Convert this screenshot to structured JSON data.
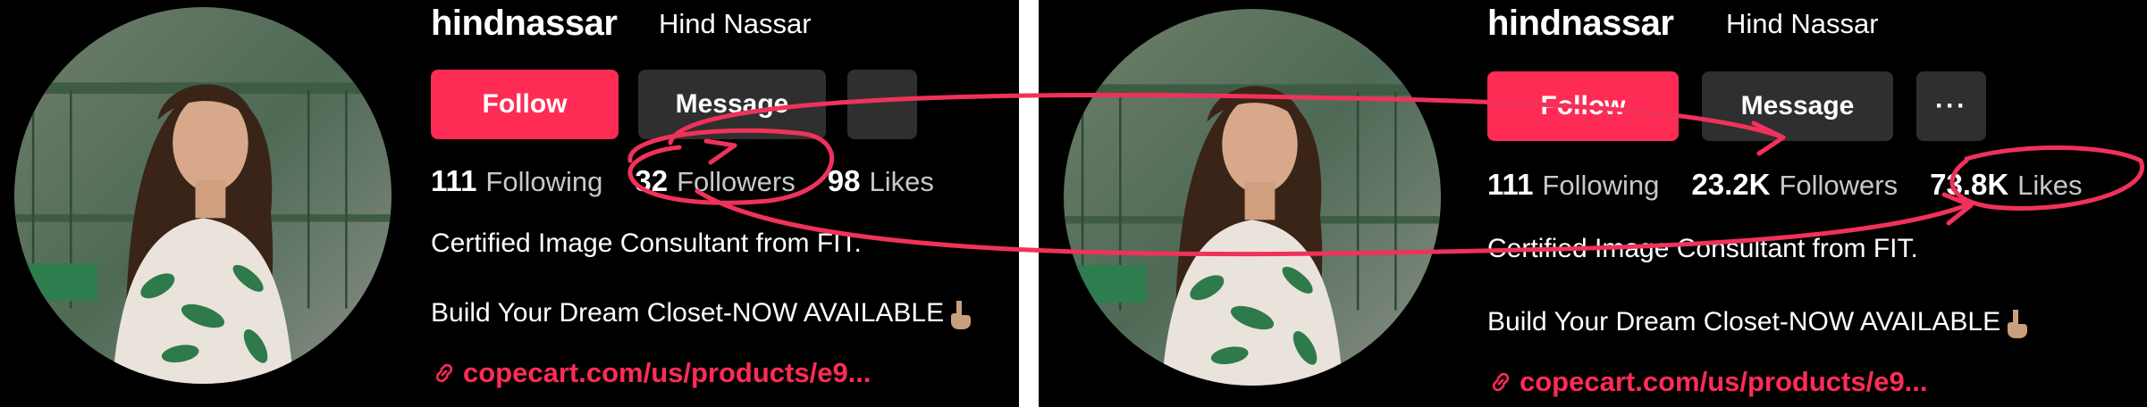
{
  "left_profile": {
    "username": "hindnassar",
    "display_name": "Hind Nassar",
    "follow_label": "Follow",
    "message_label": "Message",
    "following_count": "111",
    "following_label": "Following",
    "followers_count": "32",
    "followers_label": "Followers",
    "likes_count": "98",
    "likes_label": "Likes",
    "bio_line1": "Certified Image Consultant from FIT.",
    "bio_line2": "Build Your Dream Closet-NOW AVAILABLE",
    "link_text": "copecart.com/us/products/e9..."
  },
  "right_profile": {
    "username": "hindnassar",
    "display_name": "Hind Nassar",
    "follow_label": "Follow",
    "message_label": "Message",
    "more_label": "···",
    "following_count": "111",
    "following_label": "Following",
    "followers_count": "23.2K",
    "followers_label": "Followers",
    "likes_count": "73.8K",
    "likes_label": "Likes",
    "bio_line1": "Certified Image Consultant from FIT.",
    "bio_line2": "Build Your Dream Closet-NOW AVAILABLE",
    "link_text": "copecart.com/us/products/e9..."
  },
  "colors": {
    "accent": "#fe2c55",
    "background": "#000000",
    "secondary_button": "#2f2f2f",
    "annotation": "#f0325a"
  },
  "icons": [
    "link-icon",
    "pointing-down-hand-icon",
    "more-options-icon"
  ]
}
